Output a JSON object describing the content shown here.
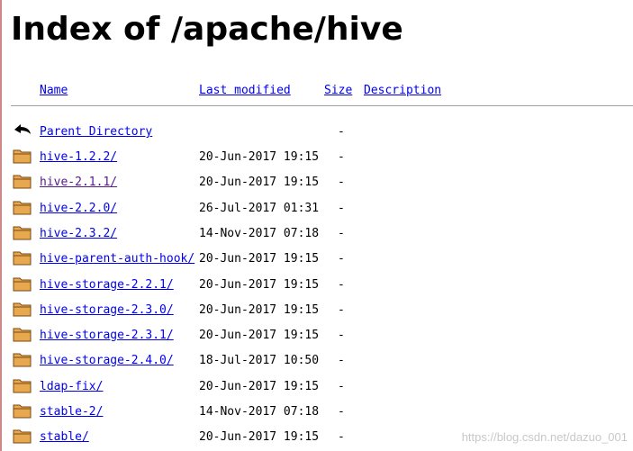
{
  "title": "Index of /apache/hive",
  "columns": {
    "name": "Name",
    "last_modified": "Last modified",
    "size": "Size",
    "description": "Description"
  },
  "parent": {
    "label": "Parent Directory",
    "date": "",
    "size": "-"
  },
  "rows": [
    {
      "name": "hive-1.2.2/",
      "date": "20-Jun-2017 19:15",
      "size": "-",
      "visited": false
    },
    {
      "name": "hive-2.1.1/",
      "date": "20-Jun-2017 19:15",
      "size": "-",
      "visited": true
    },
    {
      "name": "hive-2.2.0/",
      "date": "26-Jul-2017 01:31",
      "size": "-",
      "visited": false
    },
    {
      "name": "hive-2.3.2/",
      "date": "14-Nov-2017 07:18",
      "size": "-",
      "visited": false
    },
    {
      "name": "hive-parent-auth-hook/",
      "date": "20-Jun-2017 19:15",
      "size": "-",
      "visited": false
    },
    {
      "name": "hive-storage-2.2.1/",
      "date": "20-Jun-2017 19:15",
      "size": "-",
      "visited": false
    },
    {
      "name": "hive-storage-2.3.0/",
      "date": "20-Jun-2017 19:15",
      "size": "-",
      "visited": false
    },
    {
      "name": "hive-storage-2.3.1/",
      "date": "20-Jun-2017 19:15",
      "size": "-",
      "visited": false
    },
    {
      "name": "hive-storage-2.4.0/",
      "date": "18-Jul-2017 10:50",
      "size": "-",
      "visited": false
    },
    {
      "name": "ldap-fix/",
      "date": "20-Jun-2017 19:15",
      "size": "-",
      "visited": false
    },
    {
      "name": "stable-2/",
      "date": "14-Nov-2017 07:18",
      "size": "-",
      "visited": false
    },
    {
      "name": "stable/",
      "date": "20-Jun-2017 19:15",
      "size": "-",
      "visited": false
    }
  ],
  "icons": {
    "parent": "back-arrow-icon",
    "folder": "folder-icon"
  },
  "colors": {
    "link": "#0000ee",
    "visited": "#551a8b",
    "folder_fill": "#e8a850",
    "folder_edge": "#7a4a10"
  },
  "watermark": "https://blog.csdn.net/dazuo_001"
}
